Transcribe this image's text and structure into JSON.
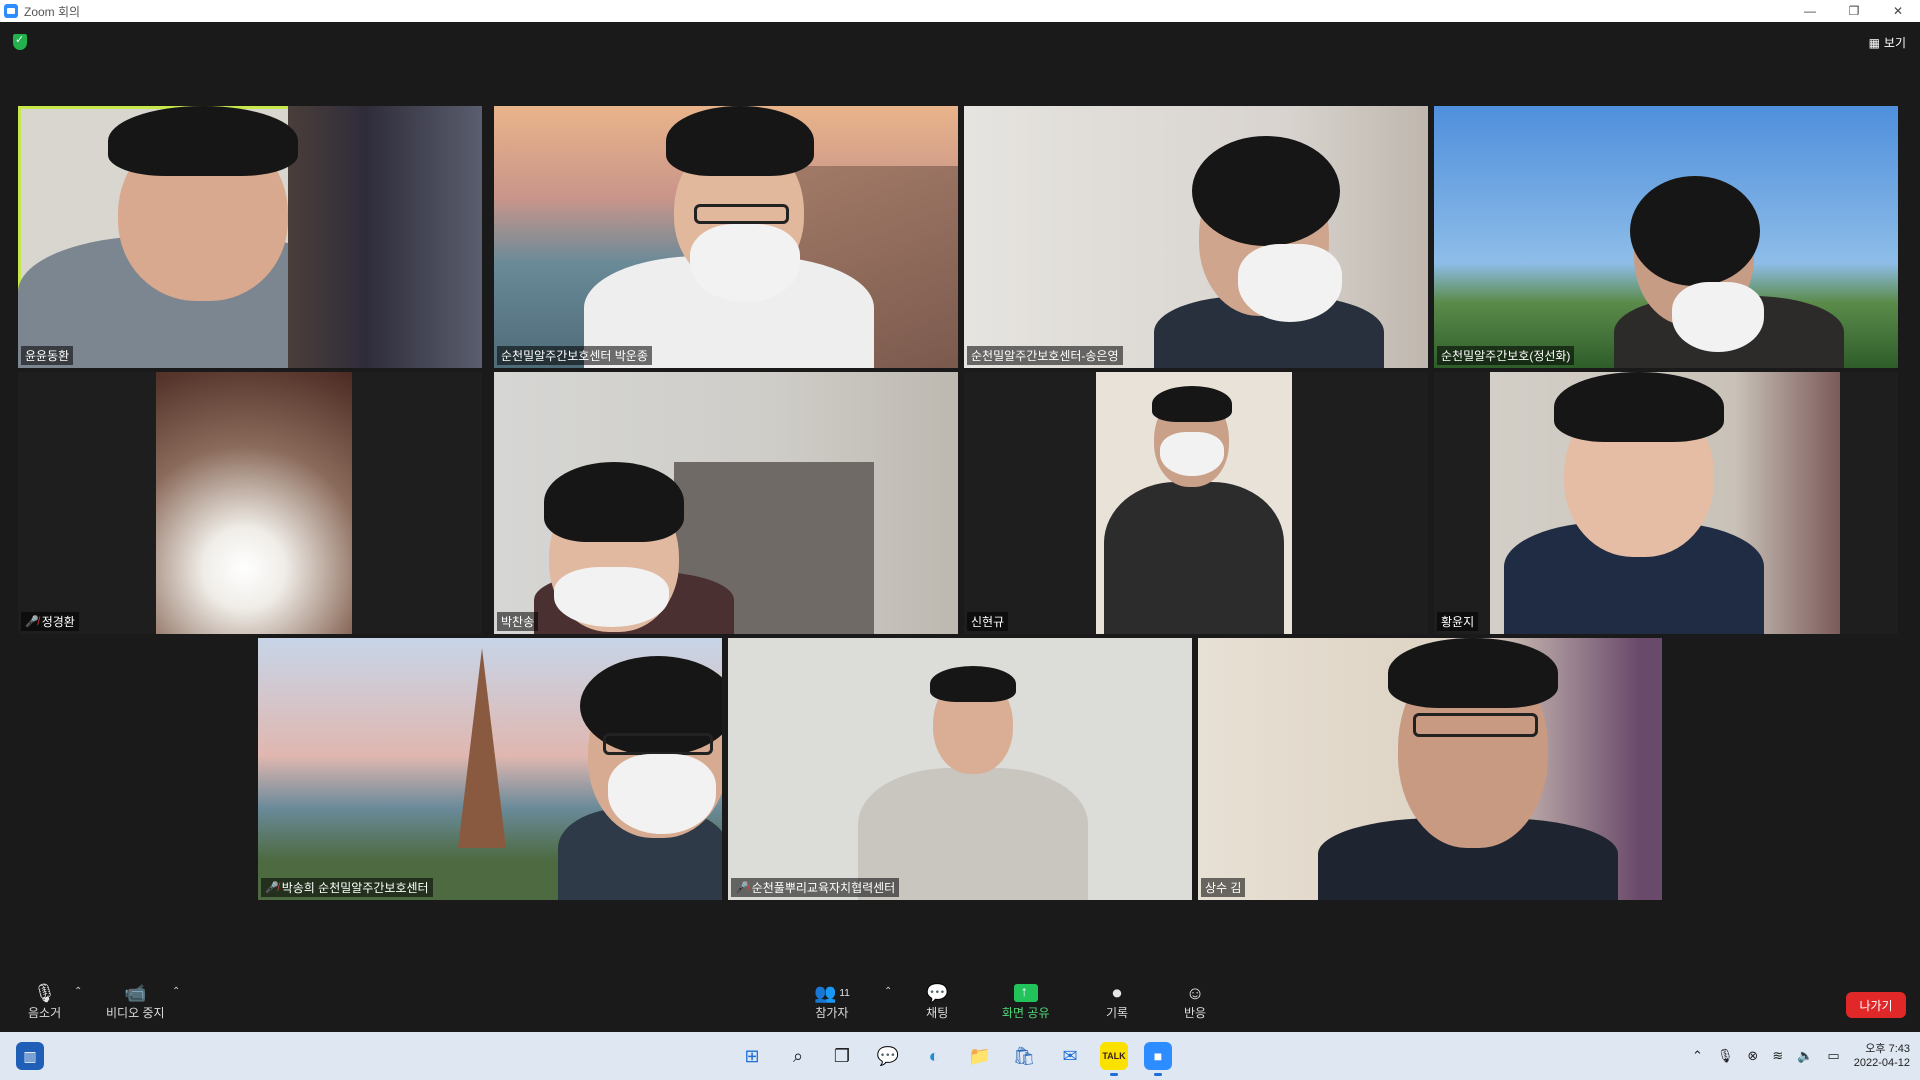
{
  "window": {
    "title": "Zoom 회의",
    "controls": [
      "—",
      "❐",
      "✕"
    ]
  },
  "top_bar": {
    "view_label": "보기"
  },
  "participants": [
    {
      "name": "윤윤동환",
      "muted": false,
      "active": true
    },
    {
      "name": "순천밀알주간보호센터 박운종",
      "muted": false
    },
    {
      "name": "순천밀알주간보호센터-송은영",
      "muted": false
    },
    {
      "name": "순천밀알주간보호(정선화)",
      "muted": false
    },
    {
      "name": "정경환",
      "muted": true
    },
    {
      "name": "박찬송",
      "muted": false
    },
    {
      "name": "신현규",
      "muted": false
    },
    {
      "name": "황윤지",
      "muted": false
    },
    {
      "name": "박송희 순천밀알주간보호센터",
      "muted": true
    },
    {
      "name": "순천풀뿌리교육자치협력센터",
      "muted": true
    },
    {
      "name": "상수 김",
      "muted": false
    }
  ],
  "toolbar": {
    "audio_label": "음소거",
    "video_label": "비디오 중지",
    "participants_label": "참가자",
    "participants_count": "11",
    "chat_label": "채팅",
    "share_label": "화면 공유",
    "record_label": "기록",
    "reactions_label": "반응",
    "leave_label": "나가기"
  },
  "taskbar": {
    "apps": [
      "widgets",
      "start",
      "search",
      "task-view",
      "teams-chat",
      "edge",
      "file-explorer",
      "store",
      "mail",
      "kakaotalk",
      "zoom"
    ],
    "time": "오후 7:43",
    "date": "2022-04-12",
    "kakaotalk_label": "TALK"
  }
}
